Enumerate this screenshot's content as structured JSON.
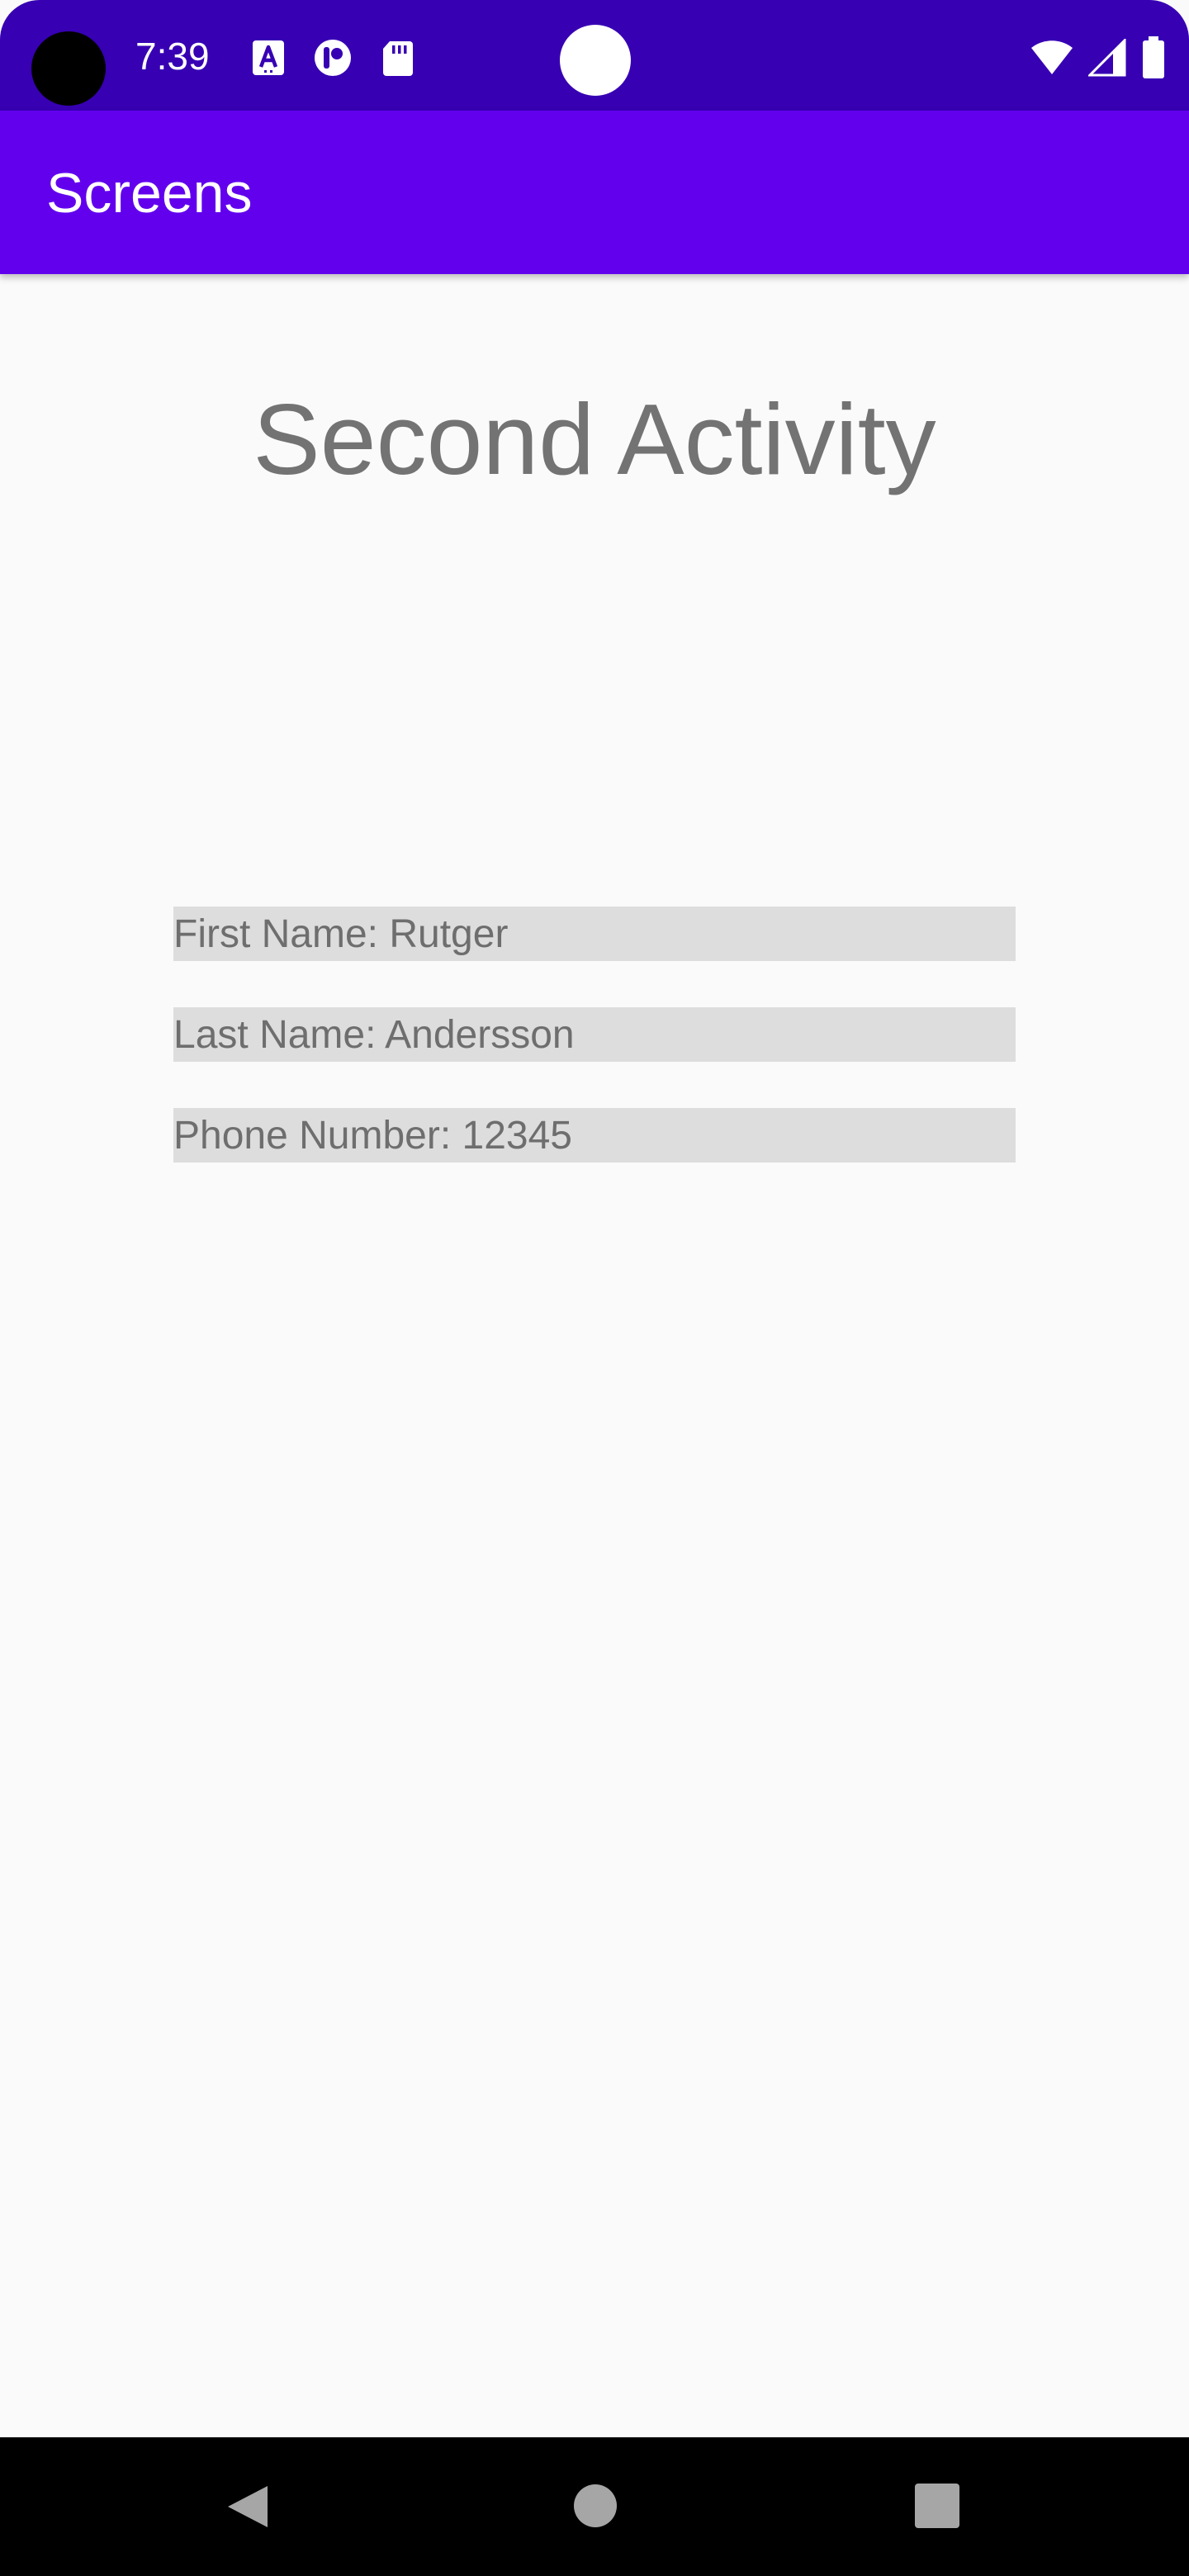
{
  "status_bar": {
    "time": "7:39",
    "background": "#3700b3",
    "icons_left": [
      "accessibility-text-icon",
      "notification-app-icon",
      "sd-card-icon"
    ],
    "icons_right": [
      "wifi-icon",
      "cell-signal-icon",
      "battery-icon"
    ]
  },
  "app_bar": {
    "title": "Screens",
    "background": "#6200ee"
  },
  "main": {
    "heading": "Second Activity",
    "fields": [
      {
        "text": "First Name: Rutger"
      },
      {
        "text": "Last Name: Andersson"
      },
      {
        "text": "Phone Number: 12345"
      }
    ]
  },
  "nav_bar": {
    "buttons": [
      "back-icon",
      "home-icon",
      "recents-icon"
    ]
  }
}
